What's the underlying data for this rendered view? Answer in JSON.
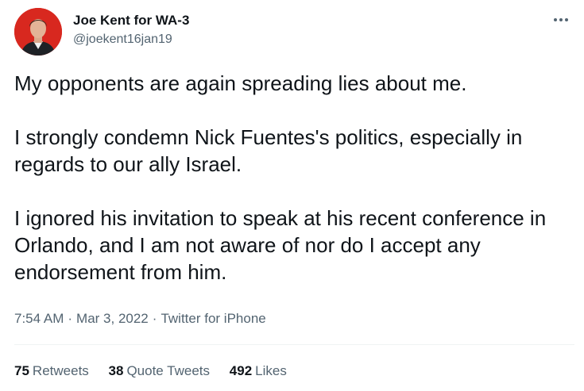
{
  "author": {
    "display_name": "Joe Kent for WA-3",
    "handle": "@joekent16jan19",
    "avatar_icon": "profile-photo"
  },
  "menu": {
    "icon": "more-horizontal-icon"
  },
  "tweet": {
    "paragraphs": [
      "My opponents are again spreading lies about me.",
      "I strongly condemn Nick Fuentes's politics, especially in regards to our ally Israel.",
      "I ignored his invitation to speak at his recent conference in Orlando, and I am not aware of nor do I accept any endorsement from him."
    ]
  },
  "meta": {
    "time": "7:54 AM",
    "separator": "·",
    "date": "Mar 3, 2022",
    "source": "Twitter for iPhone"
  },
  "stats": {
    "retweets": {
      "count": "75",
      "label": "Retweets"
    },
    "quotes": {
      "count": "38",
      "label": "Quote Tweets"
    },
    "likes": {
      "count": "492",
      "label": "Likes"
    }
  },
  "colors": {
    "text": "#0f1419",
    "secondary": "#536471",
    "avatar_bg": "#d8281f",
    "divider": "#eff3f4"
  }
}
